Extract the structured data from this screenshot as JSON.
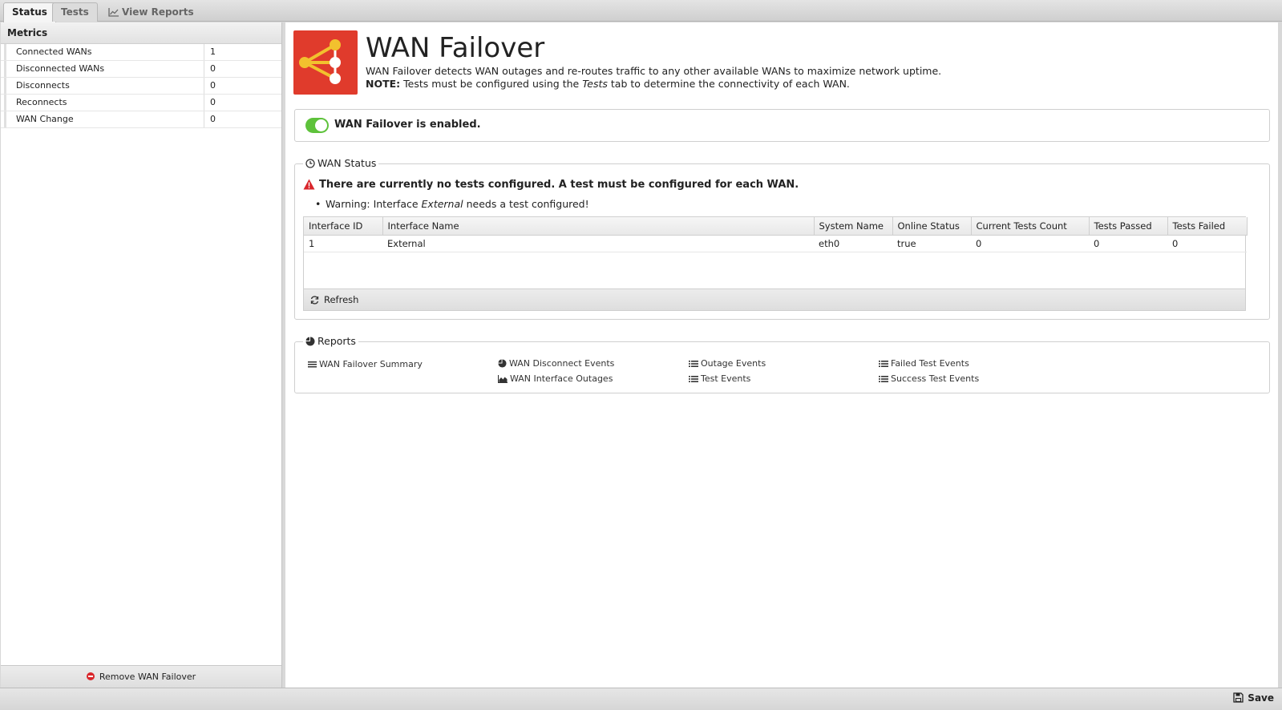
{
  "tabs": [
    {
      "label": "Status"
    },
    {
      "label": "Tests"
    },
    {
      "label": "View Reports"
    }
  ],
  "metrics": {
    "title": "Metrics",
    "rows": [
      {
        "label": "Connected WANs",
        "value": "1"
      },
      {
        "label": "Disconnected WANs",
        "value": "0"
      },
      {
        "label": "Disconnects",
        "value": "0"
      },
      {
        "label": "Reconnects",
        "value": "0"
      },
      {
        "label": "WAN Change",
        "value": "0"
      }
    ],
    "remove_label": "Remove WAN Failover"
  },
  "app": {
    "title": "WAN Failover",
    "description": "WAN Failover detects WAN outages and re-routes traffic to any other available WANs to maximize network uptime.",
    "note_label": "NOTE:",
    "note_text_1": "Tests must be configured using the",
    "note_em": "Tests",
    "note_text_2": "tab to determine the connectivity of each WAN.",
    "enabled_text": "WAN Failover is enabled.",
    "enabled": true,
    "accent_color": "#e03b2c",
    "toggle_color": "#5ec23b"
  },
  "wan_status": {
    "legend": "WAN Status",
    "warning": "There are currently no tests configured. A test must be configured for each WAN.",
    "bullet_prefix": "Warning: Interface",
    "bullet_iface": "External",
    "bullet_suffix": "needs a test configured!",
    "columns": [
      "Interface ID",
      "Interface Name",
      "System Name",
      "Online Status",
      "Current Tests Count",
      "Tests Passed",
      "Tests Failed"
    ],
    "rows": [
      [
        "1",
        "External",
        "eth0",
        "true",
        "0",
        "0",
        "0"
      ]
    ],
    "refresh_label": "Refresh"
  },
  "reports": {
    "legend": "Reports",
    "links": [
      {
        "label": "WAN Failover Summary",
        "icon": "text-lines-icon"
      },
      {
        "label": "WAN Disconnect Events",
        "icon": "pie-chart-icon"
      },
      {
        "label": "WAN Interface Outages",
        "icon": "area-chart-icon"
      },
      {
        "label": "Outage Events",
        "icon": "list-icon"
      },
      {
        "label": "Test Events",
        "icon": "list-icon"
      },
      {
        "label": "Failed Test Events",
        "icon": "list-icon"
      },
      {
        "label": "Success Test Events",
        "icon": "list-icon"
      }
    ]
  },
  "footer": {
    "save_label": "Save"
  }
}
